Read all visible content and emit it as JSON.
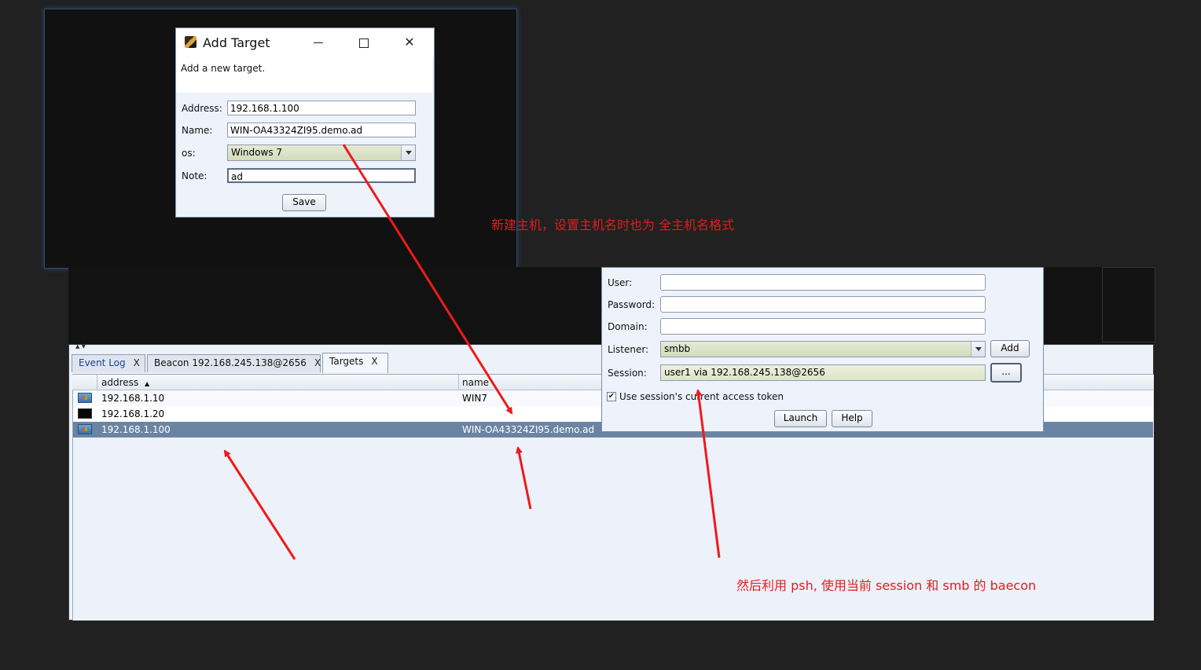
{
  "add_target_dialog": {
    "title": "Add Target",
    "description": "Add a new target.",
    "address_label": "Address:",
    "address_value": "192.168.1.100",
    "name_label": "Name:",
    "name_value": "WIN-OA43324ZI95.demo.ad",
    "os_label": "os:",
    "os_value": "Windows 7",
    "note_label": "Note:",
    "note_value": "ad",
    "save_label": "Save"
  },
  "tabs": [
    {
      "label": "Event Log",
      "close": "X"
    },
    {
      "label": "Beacon 192.168.245.138@2656",
      "close": "X"
    },
    {
      "label": "Targets",
      "close": "X"
    }
  ],
  "targets_table": {
    "columns": [
      "address",
      "name"
    ],
    "sort_indicator": "▲",
    "rows": [
      {
        "icon": "windows-host-icon",
        "address": "192.168.1.10",
        "name": "WIN7"
      },
      {
        "icon": "unknown-host-icon",
        "address": "192.168.1.20",
        "name": ""
      },
      {
        "icon": "windows-host-icon",
        "address": "192.168.1.100",
        "name": "WIN-OA43324ZI95.demo.ad"
      }
    ]
  },
  "psh_dialog": {
    "user_label": "User:",
    "user_value": "",
    "password_label": "Password:",
    "password_value": "",
    "domain_label": "Domain:",
    "domain_value": "",
    "listener_label": "Listener:",
    "listener_value": "smbb",
    "add_label": "Add",
    "session_label": "Session:",
    "session_value": "user1 via  192.168.245.138@2656",
    "browse_label": "...",
    "use_token_label": "Use session's current access token",
    "use_token_checked": "✔",
    "launch_label": "Launch",
    "help_label": "Help"
  },
  "annotations": {
    "note_top": "新建主机，设置主机名时也为 全主机名格式",
    "note_bottom": "然后利用 psh, 使用当前 session  和 smb 的 baecon",
    "color": "#e11d1d"
  }
}
